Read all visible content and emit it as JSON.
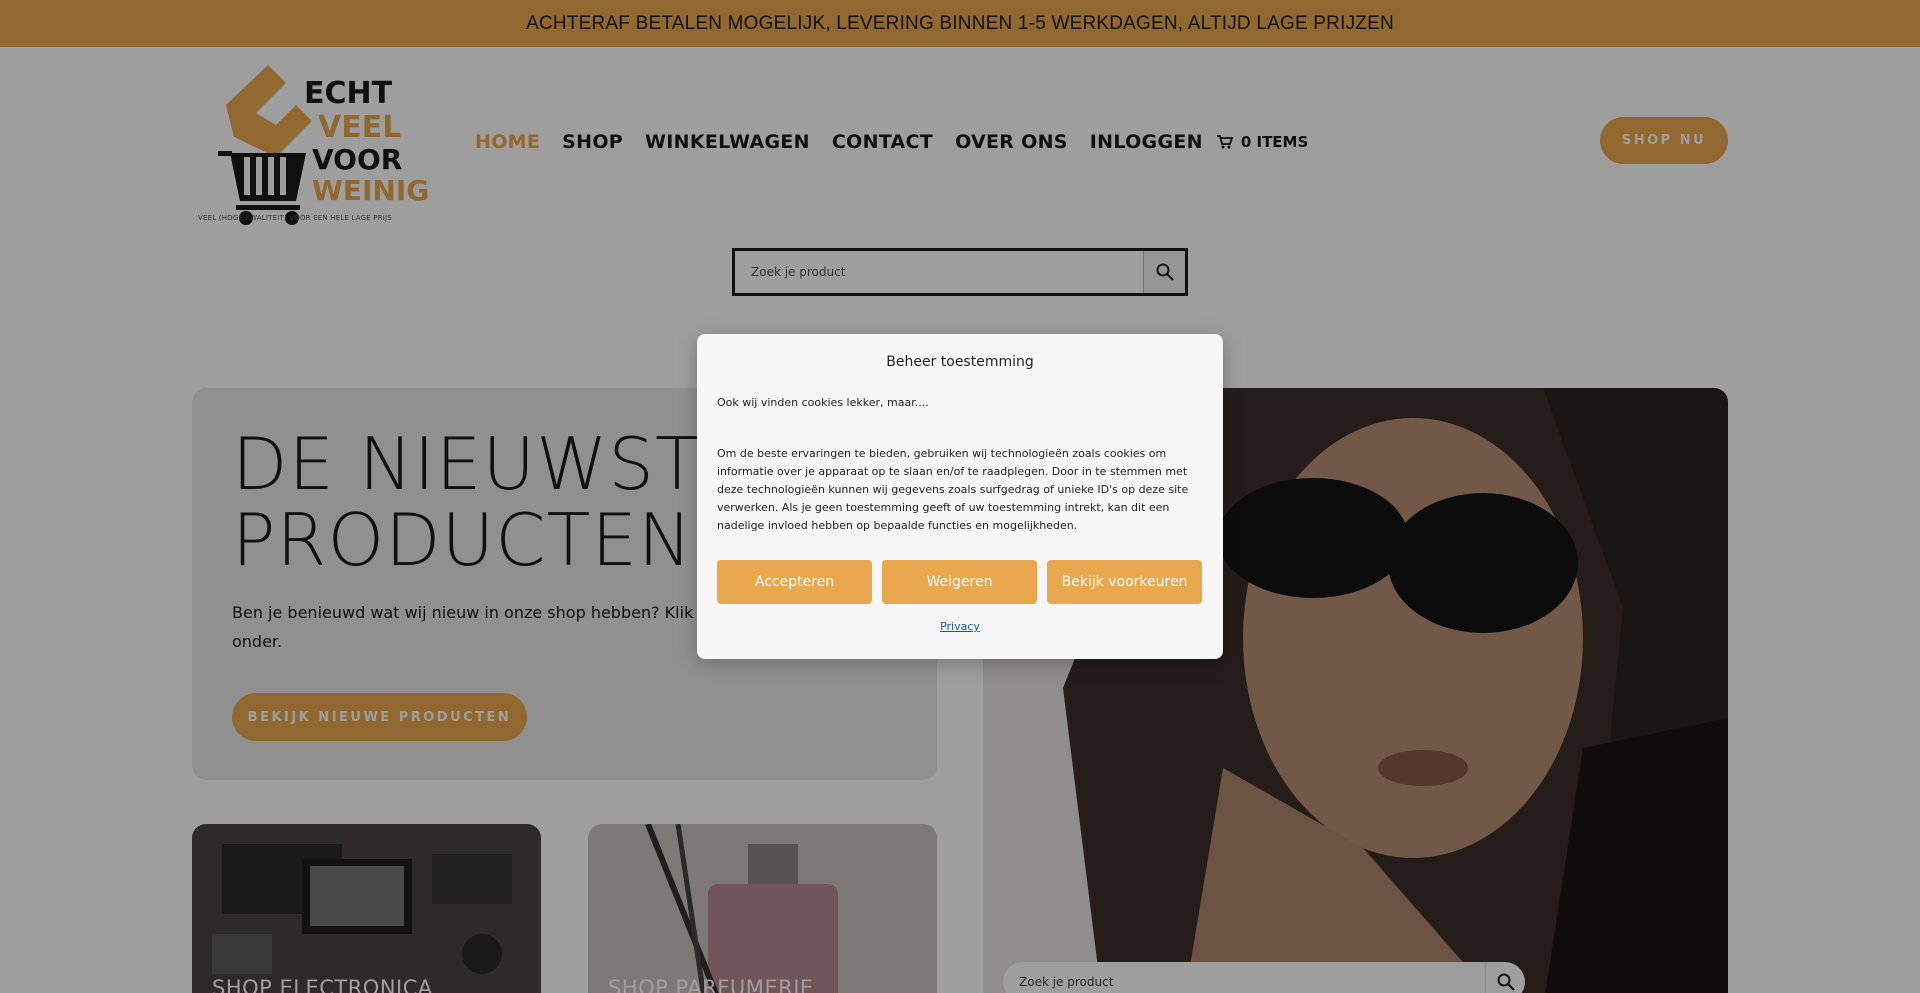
{
  "topbar": {
    "text": "ACHTERAF BETALEN MOGELIJK, LEVERING BINNEN 1-5 WERKDAGEN, ALTIJD LAGE PRIJZEN"
  },
  "logo": {
    "words": [
      "ECHT",
      "VEEL",
      "VOOR",
      "WEINIG"
    ],
    "tagline": "VEEL (HOGE KWALITEIT) VOOR EEN HELE LAGE PRIJS"
  },
  "nav": {
    "items": [
      {
        "label": "HOME",
        "active": true
      },
      {
        "label": "SHOP"
      },
      {
        "label": "WINKELWAGEN"
      },
      {
        "label": "CONTACT"
      },
      {
        "label": "OVER ONS"
      },
      {
        "label": "INLOGGEN"
      }
    ],
    "cart_label": "0 ITEMS"
  },
  "shop_now": "SHOP NU",
  "search": {
    "placeholder": "Zoek je product"
  },
  "hero": {
    "title": "DE NIEUWSTE PRODUCTEN",
    "text": "Ben je benieuwd wat wij nieuw in onze shop hebben? Klik dan op de knop hier onder.",
    "button": "BEKIJK NIEUWE PRODUCTEN"
  },
  "photo_search": {
    "placeholder": "Zoek je product"
  },
  "categories": [
    {
      "label": "SHOP ELECTRONICA"
    },
    {
      "label": "SHOP PARFUMERIE"
    }
  ],
  "modal": {
    "title": "Beheer toestemming",
    "subtitle": "Ook wij vinden cookies lekker, maar....",
    "body": "Om de beste ervaringen te bieden, gebruiken wij technologieën zoals cookies om informatie over je apparaat op te slaan en/of te raadplegen. Door in te stemmen met deze technologieën kunnen wij gegevens zoals surfgedrag of unieke ID's op deze site verwerken. Als je geen toestemming geeft of uw toestemming intrekt, kan dit een nadelige invloed hebben op bepaalde functies en mogelijkheden.",
    "buttons": {
      "accept": "Accepteren",
      "deny": "Weigeren",
      "preferences": "Bekijk voorkeuren"
    },
    "privacy": "Privacy"
  },
  "colors": {
    "accent": "#e9a84e",
    "text": "#1a1a1a",
    "link": "#1a56a6"
  }
}
